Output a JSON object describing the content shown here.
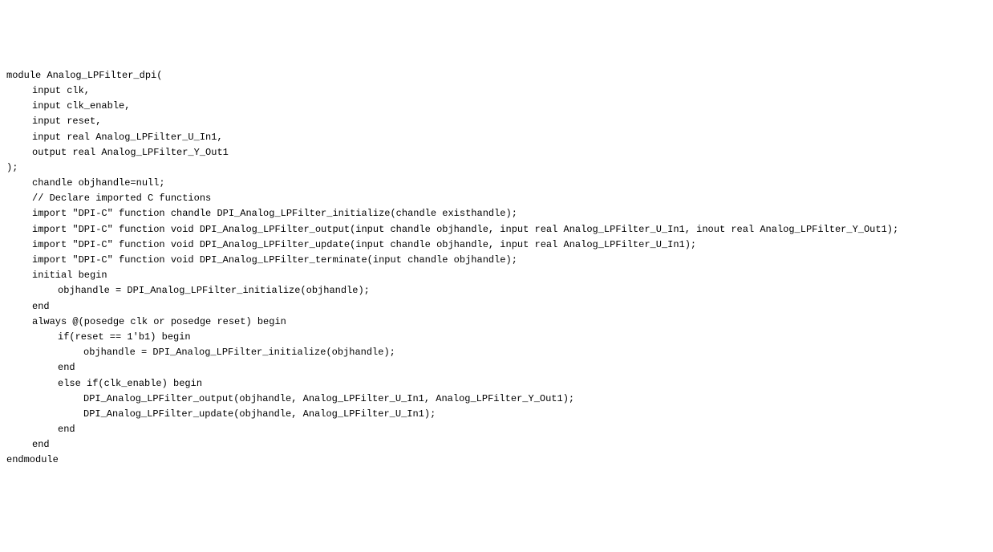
{
  "code": {
    "l1": "module Analog_LPFilter_dpi(",
    "l2": "input clk,",
    "l3": "input clk_enable,",
    "l4": "input reset,",
    "l5": "input real Analog_LPFilter_U_In1,",
    "l6": "output real Analog_LPFilter_Y_Out1",
    "l7": ");",
    "l8": "",
    "l9": "chandle objhandle=null;",
    "l10": "// Declare imported C functions",
    "l11": "import \"DPI-C\" function chandle DPI_Analog_LPFilter_initialize(chandle existhandle);",
    "l12": "import \"DPI-C\" function void DPI_Analog_LPFilter_output(input chandle objhandle, input real Analog_LPFilter_U_In1, inout real Analog_LPFilter_Y_Out1);",
    "l13": "import \"DPI-C\" function void DPI_Analog_LPFilter_update(input chandle objhandle, input real Analog_LPFilter_U_In1);",
    "l14": "import \"DPI-C\" function void DPI_Analog_LPFilter_terminate(input chandle objhandle);",
    "l15": "",
    "l16": "initial begin",
    "l17": "objhandle = DPI_Analog_LPFilter_initialize(objhandle);",
    "l18": "end",
    "l19": "",
    "l20": "always @(posedge clk or posedge reset) begin",
    "l21": "if(reset == 1'b1) begin",
    "l22": "objhandle = DPI_Analog_LPFilter_initialize(objhandle);",
    "l23": "end",
    "l24": "else if(clk_enable) begin",
    "l25": "DPI_Analog_LPFilter_output(objhandle, Analog_LPFilter_U_In1, Analog_LPFilter_Y_Out1);",
    "l26": "DPI_Analog_LPFilter_update(objhandle, Analog_LPFilter_U_In1);",
    "l27": "end",
    "l28": "end",
    "l29": "endmodule"
  }
}
